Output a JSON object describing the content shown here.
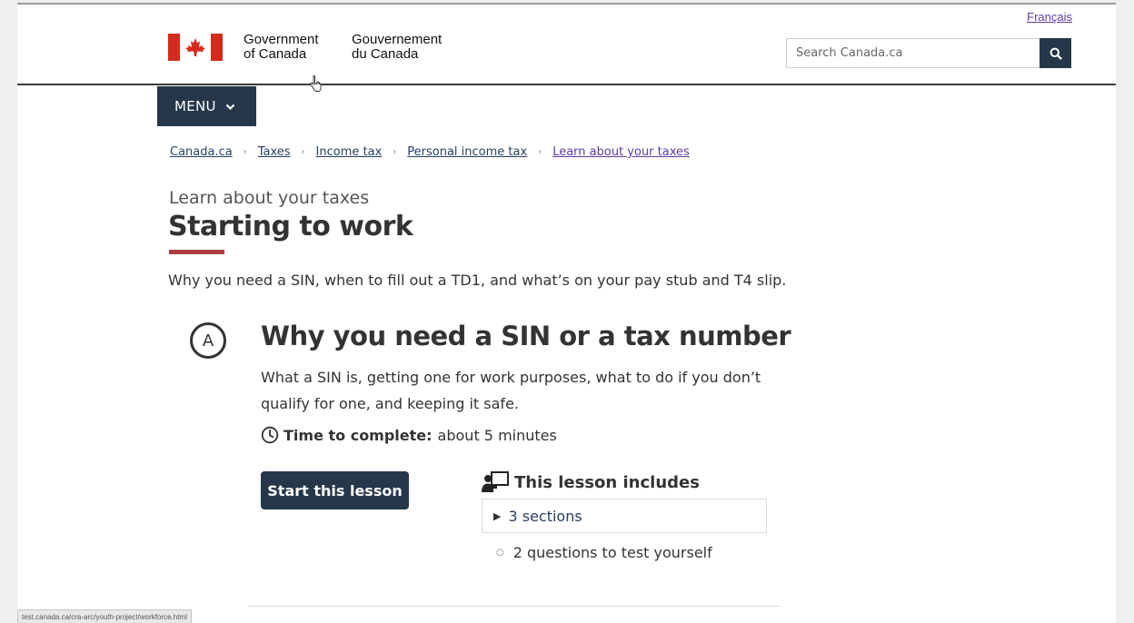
{
  "header": {
    "language_link": "Français",
    "gov_en_line1": "Government",
    "gov_en_line2": "of Canada",
    "gov_fr_line1": "Gouvernement",
    "gov_fr_line2": "du Canada",
    "search_placeholder": "Search Canada.ca",
    "search_icon": "magnifier-icon",
    "flag_icon": "canada-flag-icon",
    "accent_color": "#26374a",
    "flag_color": "#d52b1e"
  },
  "menu": {
    "label": "MENU",
    "icon": "chevron-down-icon"
  },
  "breadcrumb": {
    "items": [
      "Canada.ca",
      "Taxes",
      "Income tax",
      "Personal income tax",
      "Learn about your taxes"
    ]
  },
  "page": {
    "kicker": "Learn about your taxes",
    "title": "Starting to work",
    "title_rule_color": "#af3c43",
    "intro": "Why you need a SIN, when to fill out a TD1, and what’s on your pay stub and T4 slip."
  },
  "lesson": {
    "badge": "A",
    "title": "Why you need a SIN or a tax number",
    "description": "What a SIN is, getting one for work purposes, what to do if you don’t qualify for one, and keeping it safe.",
    "time_label": "Time to complete:",
    "time_value": "about 5 minutes",
    "start_button": "Start this lesson",
    "includes_heading": "This lesson includes",
    "sections_label": "3 sections",
    "questions_label": "2 questions to test yourself"
  },
  "status_bar": {
    "url": "test.canada.ca/cra-arc/youth-project/workforce.html"
  }
}
